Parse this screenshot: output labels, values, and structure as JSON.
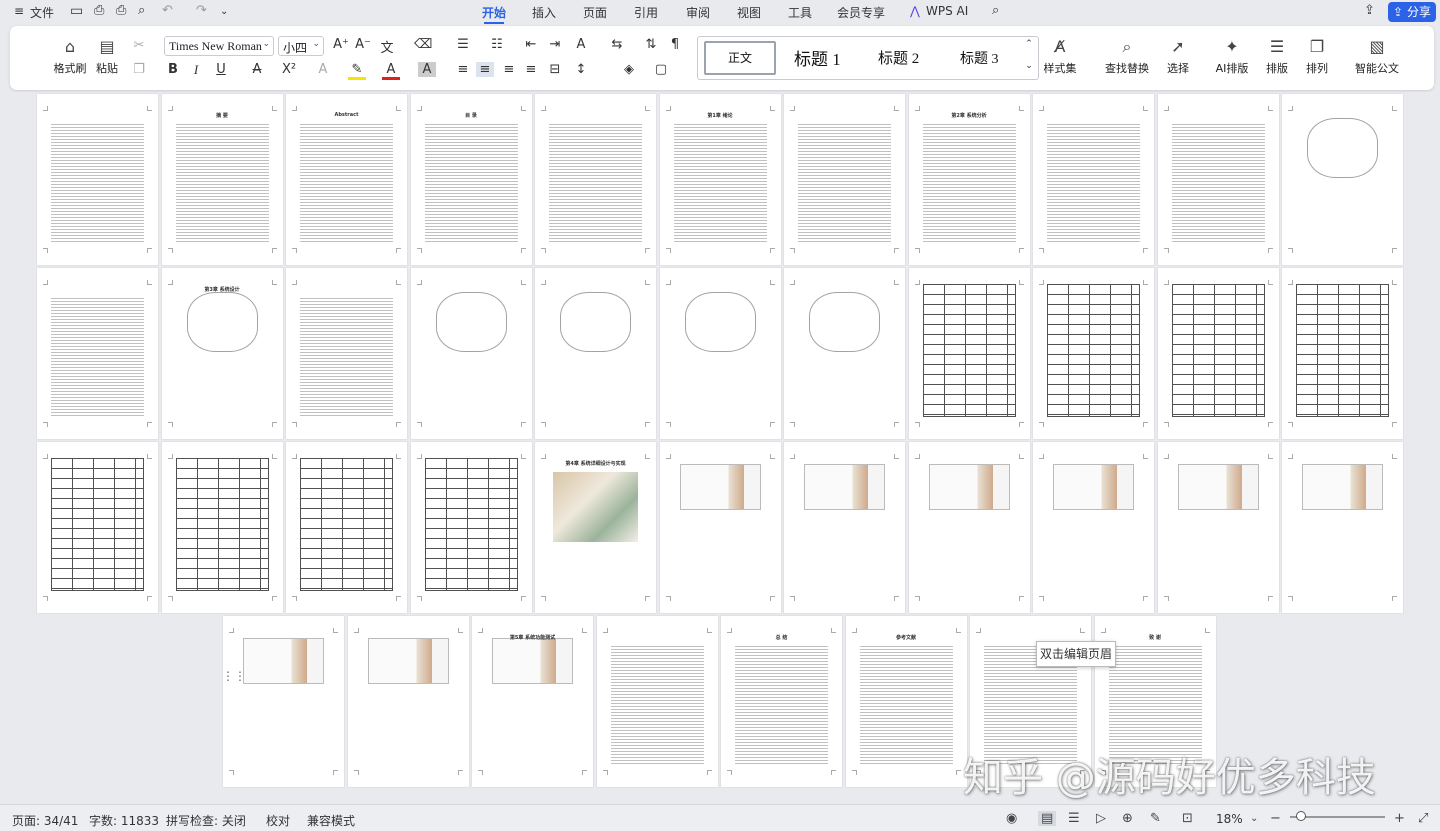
{
  "menubar": {
    "menu_icon": "≡",
    "file": "文件",
    "tabs": [
      "开始",
      "插入",
      "页面",
      "引用",
      "审阅",
      "视图",
      "工具",
      "会员专享",
      "WPS AI"
    ],
    "share": "分享"
  },
  "ribbon": {
    "format_painter": "格式刷",
    "paste": "粘贴",
    "font_name": "Times New Roman",
    "font_size": "小四",
    "styles": {
      "normal": "正文",
      "h1": "标题 1",
      "h2": "标题 2",
      "h3": "标题 3"
    },
    "style_set": "样式集",
    "find_replace": "查找替换",
    "select": "选择",
    "ai_layout": "AI排版",
    "layout": "排版",
    "arrange": "排列",
    "smart_doc": "智能公文"
  },
  "pages": {
    "titles": [
      "",
      "摘 要",
      "Abstract",
      "目 录",
      "",
      "第1章 绪论",
      "",
      "第2章 系统分析",
      "",
      "",
      "",
      "",
      "第3章 系统设计",
      "",
      "",
      "",
      "",
      "",
      "",
      "",
      "",
      "",
      "",
      "",
      "",
      "",
      "第4章 系统详细设计与实现",
      "",
      "",
      "",
      "",
      "",
      "",
      "",
      "",
      "第5章 系统功能测试",
      "",
      "总 结",
      "参考文献",
      "",
      "致 谢"
    ]
  },
  "tooltip": "双击编辑页眉",
  "watermark": "知乎 @源码好优多科技",
  "status": {
    "page": "页面: 34/41",
    "words": "字数: 11833",
    "spell": "拼写检查: 关闭",
    "proof": "校对",
    "compat": "兼容模式",
    "zoom": "18%"
  }
}
